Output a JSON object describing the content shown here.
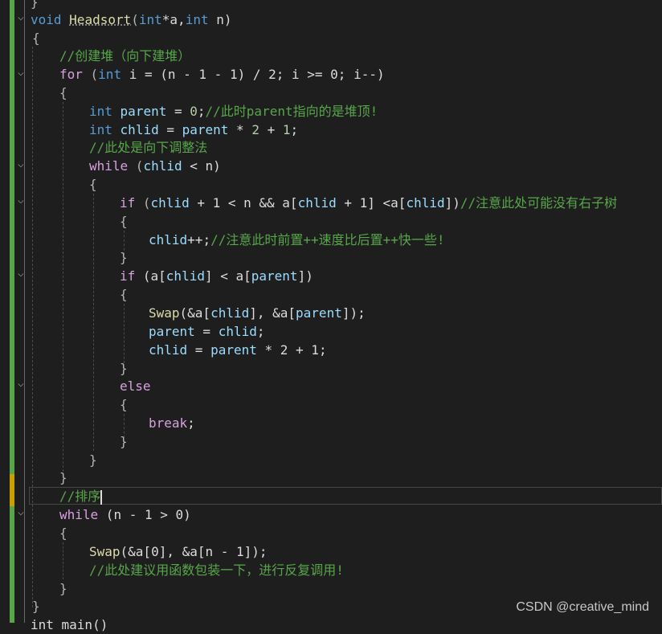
{
  "editor": {
    "theme_colors": {
      "background": "#1e1e1e",
      "keyword": "#569cd6",
      "control": "#d8a0df",
      "function": "#dcdcaa",
      "variable": "#9cdcfe",
      "number": "#b5cea8",
      "comment": "#57a64a",
      "change_bar": "#57a64a"
    },
    "lines": [
      {
        "tokens": [
          {
            "t": "}",
            "c": "pun"
          }
        ]
      },
      {
        "tokens": [
          {
            "t": "void",
            "c": "kw"
          },
          {
            "t": " ",
            "c": "txt"
          },
          {
            "t": "Headsort",
            "c": "fn"
          },
          {
            "t": "(",
            "c": "pun"
          },
          {
            "t": "int",
            "c": "kw"
          },
          {
            "t": "*a,",
            "c": "txt"
          },
          {
            "t": "int",
            "c": "kw"
          },
          {
            "t": " n)",
            "c": "txt"
          }
        ]
      },
      {
        "tokens": [
          {
            "t": "{",
            "c": "pun"
          }
        ]
      },
      {
        "tokens": [
          {
            "t": "//创建堆（向下建堆）",
            "c": "cmt"
          }
        ]
      },
      {
        "tokens": [
          {
            "t": "for",
            "c": "ctl"
          },
          {
            "t": " (",
            "c": "pun"
          },
          {
            "t": "int",
            "c": "kw"
          },
          {
            "t": " i = (n - 1 - 1) / 2; i >= 0; i--)",
            "c": "txt"
          }
        ]
      },
      {
        "tokens": [
          {
            "t": "{",
            "c": "pun"
          }
        ]
      },
      {
        "tokens": [
          {
            "t": "int",
            "c": "kw"
          },
          {
            "t": " ",
            "c": "txt"
          },
          {
            "t": "parent",
            "c": "var"
          },
          {
            "t": " = ",
            "c": "txt"
          },
          {
            "t": "0",
            "c": "num"
          },
          {
            "t": ";",
            "c": "txt"
          },
          {
            "t": "//此时parent指向的是堆顶!",
            "c": "cmt"
          }
        ]
      },
      {
        "tokens": [
          {
            "t": "int",
            "c": "kw"
          },
          {
            "t": " ",
            "c": "txt"
          },
          {
            "t": "chlid",
            "c": "var"
          },
          {
            "t": " = ",
            "c": "txt"
          },
          {
            "t": "parent",
            "c": "var"
          },
          {
            "t": " * ",
            "c": "txt"
          },
          {
            "t": "2",
            "c": "num"
          },
          {
            "t": " + ",
            "c": "txt"
          },
          {
            "t": "1",
            "c": "num"
          },
          {
            "t": ";",
            "c": "txt"
          }
        ]
      },
      {
        "tokens": [
          {
            "t": "//此处是向下调整法",
            "c": "cmt"
          }
        ]
      },
      {
        "tokens": [
          {
            "t": "while",
            "c": "ctl"
          },
          {
            "t": " (",
            "c": "pun"
          },
          {
            "t": "chlid",
            "c": "var"
          },
          {
            "t": " < n)",
            "c": "txt"
          }
        ]
      },
      {
        "tokens": [
          {
            "t": "{",
            "c": "pun"
          }
        ]
      },
      {
        "tokens": [
          {
            "t": "if",
            "c": "ctl"
          },
          {
            "t": " (",
            "c": "pun"
          },
          {
            "t": "chlid",
            "c": "var"
          },
          {
            "t": " + 1 < n && a[",
            "c": "txt"
          },
          {
            "t": "chlid",
            "c": "var"
          },
          {
            "t": " + 1] <a[",
            "c": "txt"
          },
          {
            "t": "chlid",
            "c": "var"
          },
          {
            "t": "])",
            "c": "txt"
          },
          {
            "t": "//注意此处可能没有右子树",
            "c": "cmt"
          }
        ]
      },
      {
        "tokens": [
          {
            "t": "{",
            "c": "pun"
          }
        ]
      },
      {
        "tokens": [
          {
            "t": "chlid",
            "c": "var"
          },
          {
            "t": "++;",
            "c": "txt"
          },
          {
            "t": "//注意此时前置++速度比后置++快一些!",
            "c": "cmt"
          }
        ]
      },
      {
        "tokens": [
          {
            "t": "}",
            "c": "pun"
          }
        ]
      },
      {
        "tokens": [
          {
            "t": "if",
            "c": "ctl"
          },
          {
            "t": " (a[",
            "c": "txt"
          },
          {
            "t": "chlid",
            "c": "var"
          },
          {
            "t": "] < a[",
            "c": "txt"
          },
          {
            "t": "parent",
            "c": "var"
          },
          {
            "t": "])",
            "c": "txt"
          }
        ]
      },
      {
        "tokens": [
          {
            "t": "{",
            "c": "pun"
          }
        ]
      },
      {
        "tokens": [
          {
            "t": "Swap",
            "c": "fn"
          },
          {
            "t": "(&a[",
            "c": "txt"
          },
          {
            "t": "chlid",
            "c": "var"
          },
          {
            "t": "], &a[",
            "c": "txt"
          },
          {
            "t": "parent",
            "c": "var"
          },
          {
            "t": "]);",
            "c": "txt"
          }
        ]
      },
      {
        "tokens": [
          {
            "t": "parent",
            "c": "var"
          },
          {
            "t": " = ",
            "c": "txt"
          },
          {
            "t": "chlid",
            "c": "var"
          },
          {
            "t": ";",
            "c": "txt"
          }
        ]
      },
      {
        "tokens": [
          {
            "t": "chlid",
            "c": "var"
          },
          {
            "t": " = ",
            "c": "txt"
          },
          {
            "t": "parent",
            "c": "var"
          },
          {
            "t": " * 2 + 1;",
            "c": "txt"
          }
        ]
      },
      {
        "tokens": [
          {
            "t": "}",
            "c": "pun"
          }
        ]
      },
      {
        "tokens": [
          {
            "t": "else",
            "c": "ctl"
          }
        ]
      },
      {
        "tokens": [
          {
            "t": "{",
            "c": "pun"
          }
        ]
      },
      {
        "tokens": [
          {
            "t": "break",
            "c": "ctl"
          },
          {
            "t": ";",
            "c": "txt"
          }
        ]
      },
      {
        "tokens": [
          {
            "t": "}",
            "c": "pun"
          }
        ]
      },
      {
        "tokens": [
          {
            "t": "}",
            "c": "pun"
          }
        ]
      },
      {
        "tokens": [
          {
            "t": "}",
            "c": "pun"
          }
        ]
      },
      {
        "tokens": [
          {
            "t": "//排序",
            "c": "cmt"
          }
        ]
      },
      {
        "tokens": [
          {
            "t": "while",
            "c": "ctl"
          },
          {
            "t": " (n - 1 > 0)",
            "c": "txt"
          }
        ]
      },
      {
        "tokens": [
          {
            "t": "{",
            "c": "pun"
          }
        ]
      },
      {
        "tokens": [
          {
            "t": "Swap",
            "c": "fn"
          },
          {
            "t": "(&a[0], &a[n - 1]);",
            "c": "txt"
          }
        ]
      },
      {
        "tokens": [
          {
            "t": "//此处建议用函数包装一下，进行反复调用!",
            "c": "cmt"
          }
        ]
      },
      {
        "tokens": [
          {
            "t": "}",
            "c": "pun"
          }
        ]
      },
      {
        "tokens": [
          {
            "t": "}",
            "c": "pun"
          }
        ]
      },
      {
        "tokens": [
          {
            "t": "int main()",
            "c": "txt"
          }
        ]
      }
    ]
  },
  "watermark": "CSDN @creative_mind"
}
